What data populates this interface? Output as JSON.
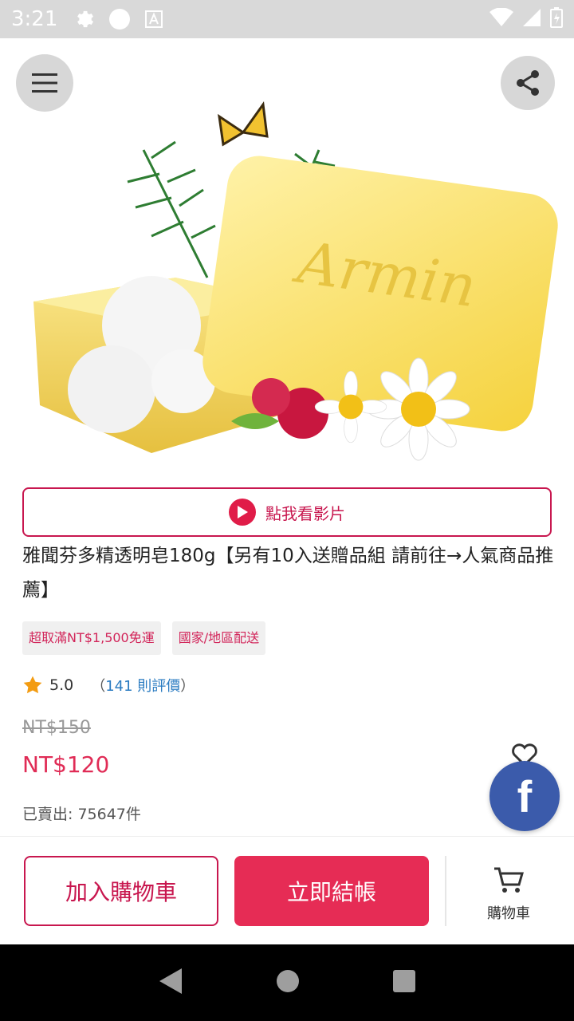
{
  "status_bar": {
    "time": "3:21"
  },
  "product": {
    "video_label": "點我看影片",
    "title": "雅聞芬多精透明皂180g【另有10入送贈品組 請前往→人氣商品推薦】",
    "tags": [
      "超取滿NT$1,500免運",
      "國家/地區配送"
    ],
    "rating": "5.0",
    "reviews_open": "（",
    "reviews_label": "141 則評價",
    "reviews_close": "）",
    "original_price": "NT$150",
    "price": "NT$120",
    "sold": "已賣出: 75647件",
    "image_wordmark": "Armin"
  },
  "bottom_bar": {
    "add_to_cart": "加入購物車",
    "checkout": "立即結帳",
    "cart_label": "購物車"
  },
  "fb_label": "f",
  "colors": {
    "accent": "#e62c55",
    "accent_border": "#c8174f",
    "link": "#2a7bc1",
    "facebook": "#3b5bab"
  }
}
